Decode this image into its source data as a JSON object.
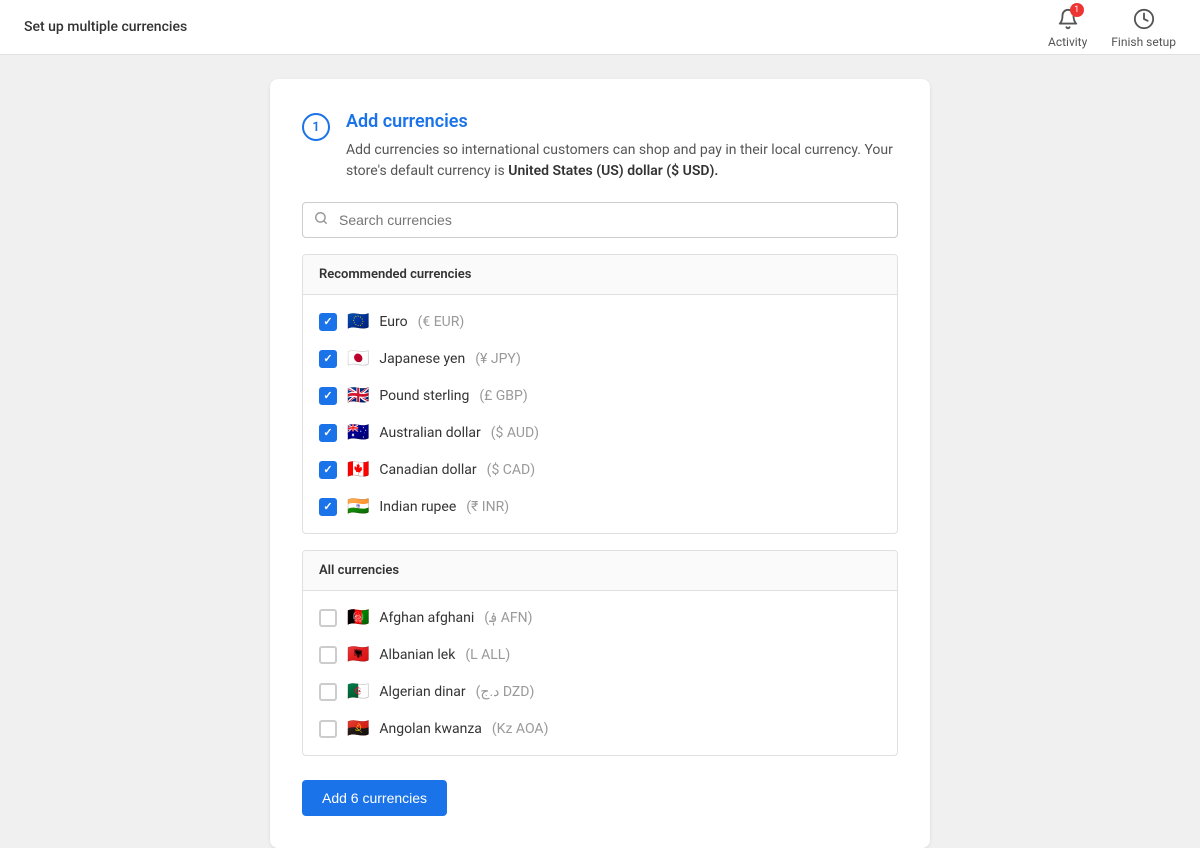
{
  "header": {
    "title": "Set up multiple currencies",
    "activity_label": "Activity",
    "finish_setup_label": "Finish setup",
    "activity_badge": "1"
  },
  "step": {
    "number": "1",
    "title": "Add currencies",
    "description": "Add currencies so international customers can shop and pay in their local currency. Your store's default currency is ",
    "description_strong": "United States (US) dollar ($ USD).",
    "description_end": ""
  },
  "search": {
    "placeholder": "Search currencies"
  },
  "recommended": {
    "label": "Recommended currencies",
    "items": [
      {
        "flag": "🇪🇺",
        "name": "Euro",
        "code": "(€ EUR)",
        "checked": true
      },
      {
        "flag": "🇯🇵",
        "name": "Japanese yen",
        "code": "(¥ JPY)",
        "checked": true
      },
      {
        "flag": "🇬🇧",
        "name": "Pound sterling",
        "code": "(£ GBP)",
        "checked": true
      },
      {
        "flag": "🇦🇺",
        "name": "Australian dollar",
        "code": "($ AUD)",
        "checked": true
      },
      {
        "flag": "🇨🇦",
        "name": "Canadian dollar",
        "code": "($ CAD)",
        "checked": true
      },
      {
        "flag": "🇮🇳",
        "name": "Indian rupee",
        "code": "(₹ INR)",
        "checked": true
      }
    ]
  },
  "all_currencies": {
    "label": "All currencies",
    "items": [
      {
        "flag": "🇦🇫",
        "name": "Afghan afghani",
        "code": "(؋ AFN)",
        "checked": false
      },
      {
        "flag": "🇦🇱",
        "name": "Albanian lek",
        "code": "(L ALL)",
        "checked": false
      },
      {
        "flag": "🇩🇿",
        "name": "Algerian dinar",
        "code": "(د.ج DZD)",
        "checked": false
      },
      {
        "flag": "🇦🇴",
        "name": "Angolan kwanza",
        "code": "(Kz AOA)",
        "checked": false
      }
    ]
  },
  "add_button": {
    "label": "Add 6 currencies"
  }
}
